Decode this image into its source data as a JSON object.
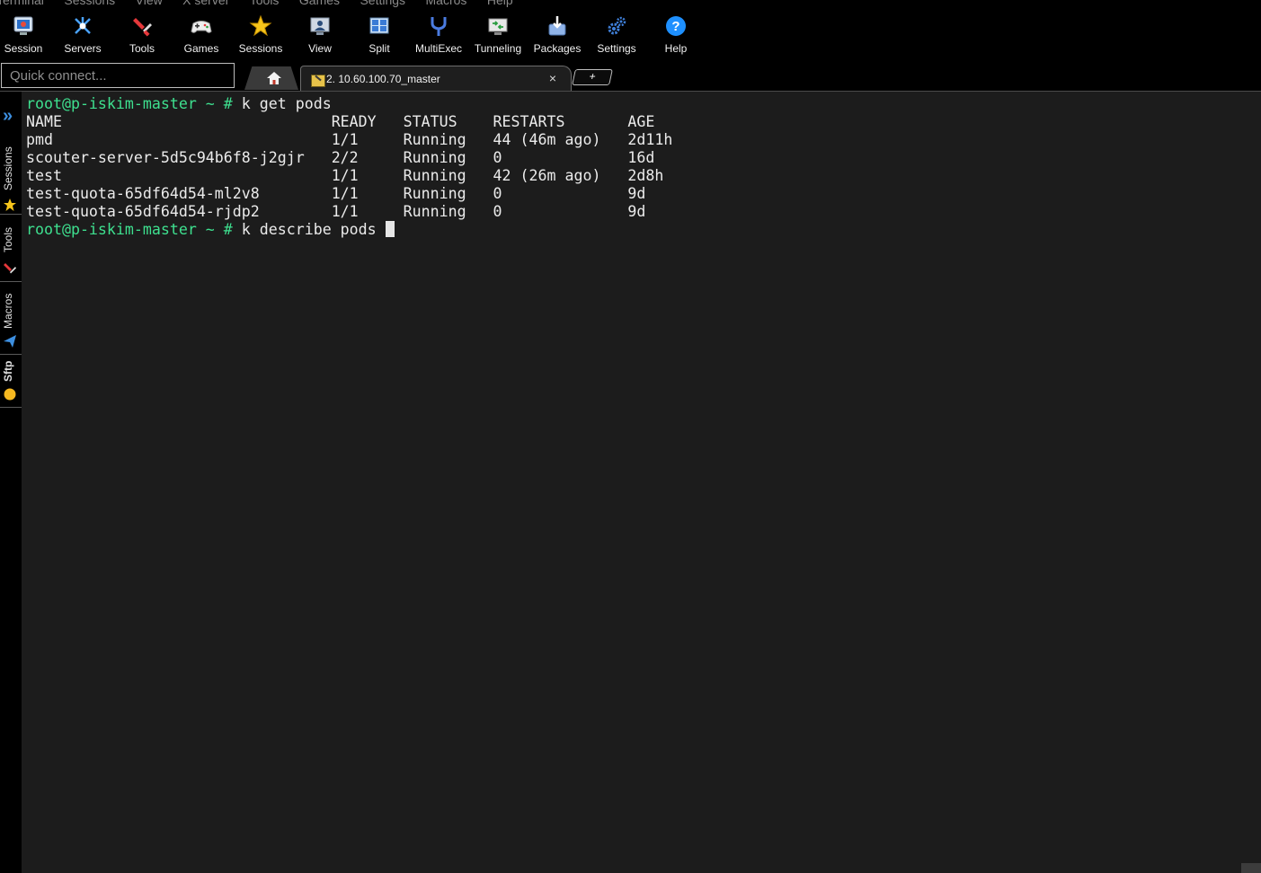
{
  "menu": [
    "Terminal",
    "Sessions",
    "View",
    "X server",
    "Tools",
    "Games",
    "Settings",
    "Macros",
    "Help"
  ],
  "toolbar": [
    {
      "label": "Session",
      "icon": "session-icon"
    },
    {
      "label": "Servers",
      "icon": "servers-icon"
    },
    {
      "label": "Tools",
      "icon": "tools-icon"
    },
    {
      "label": "Games",
      "icon": "games-icon"
    },
    {
      "label": "Sessions",
      "icon": "star-icon"
    },
    {
      "label": "View",
      "icon": "view-icon"
    },
    {
      "label": "Split",
      "icon": "split-icon"
    },
    {
      "label": "MultiExec",
      "icon": "multiexec-icon"
    },
    {
      "label": "Tunneling",
      "icon": "tunneling-icon"
    },
    {
      "label": "Packages",
      "icon": "packages-icon"
    },
    {
      "label": "Settings",
      "icon": "gears-icon"
    },
    {
      "label": "Help",
      "icon": "help-icon"
    }
  ],
  "quick_connect": {
    "placeholder": "Quick connect..."
  },
  "tabs": {
    "home_icon": "home-icon",
    "session_label": "2. 10.60.100.70_master",
    "close_glyph": "×",
    "new_tab_glyph": "+"
  },
  "sidebar": [
    "Sessions",
    "Tools",
    "Macros",
    "Sftp"
  ],
  "terminal": {
    "prompt": "root@p-iskim-master ~ # ",
    "command1": "k get pods",
    "command2": "k describe pods ",
    "headers": [
      "NAME",
      "READY",
      "STATUS",
      "RESTARTS",
      "AGE"
    ],
    "rows": [
      [
        "pmd",
        "1/1",
        "Running",
        "44 (46m ago)",
        "2d11h"
      ],
      [
        "scouter-server-5d5c94b6f8-j2gjr",
        "2/2",
        "Running",
        "0",
        "16d"
      ],
      [
        "test",
        "1/1",
        "Running",
        "42 (26m ago)",
        "2d8h"
      ],
      [
        "test-quota-65df64d54-ml2v8",
        "1/1",
        "Running",
        "0",
        "9d"
      ],
      [
        "test-quota-65df64d54-rjdp2",
        "1/1",
        "Running",
        "0",
        "9d"
      ]
    ]
  },
  "colors": {
    "prompt": "#3ee08f",
    "terminal_bg": "#1c1c1c",
    "accent": "#3d8fe0"
  }
}
